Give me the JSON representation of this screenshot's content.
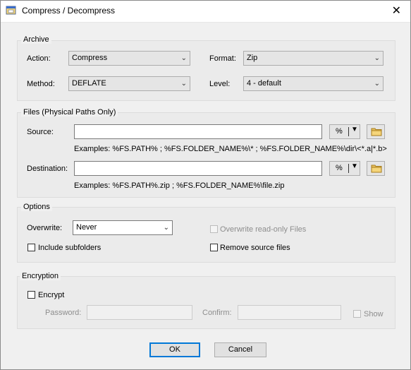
{
  "window": {
    "title": "Compress / Decompress",
    "close_glyph": "✕"
  },
  "archive": {
    "group_title": "Archive",
    "action_label": "Action:",
    "action_value": "Compress",
    "format_label": "Format:",
    "format_value": "Zip",
    "method_label": "Method:",
    "method_value": "DEFLATE",
    "level_label": "Level:",
    "level_value": "4 - default"
  },
  "files": {
    "group_title": "Files (Physical Paths Only)",
    "source_label": "Source:",
    "source_value": "",
    "source_examples": "Examples: %FS.PATH% ; %FS.FOLDER_NAME%\\* ; %FS.FOLDER_NAME%\\dir\\<*.a|*.b>",
    "destination_label": "Destination:",
    "destination_value": "",
    "destination_examples": "Examples: %FS.PATH%.zip ; %FS.FOLDER_NAME%\\file.zip",
    "percent_label": "%"
  },
  "options": {
    "group_title": "Options",
    "overwrite_label": "Overwrite:",
    "overwrite_value": "Never",
    "overwrite_readonly_label": "Overwrite read-only Files",
    "include_subfolders_label": "Include subfolders",
    "remove_source_label": "Remove source files"
  },
  "encryption": {
    "group_title": "Encryption",
    "encrypt_label": "Encrypt",
    "password_label": "Password:",
    "confirm_label": "Confirm:",
    "show_label": "Show"
  },
  "buttons": {
    "ok": "OK",
    "cancel": "Cancel"
  },
  "colors": {
    "accent": "#0078d7",
    "group_bg": "#ebebeb",
    "window_bg": "#f0f0f0"
  },
  "icons": {
    "app": "app-window-icon",
    "folder": "folder-icon",
    "dropdown": "chevron-down-icon"
  }
}
